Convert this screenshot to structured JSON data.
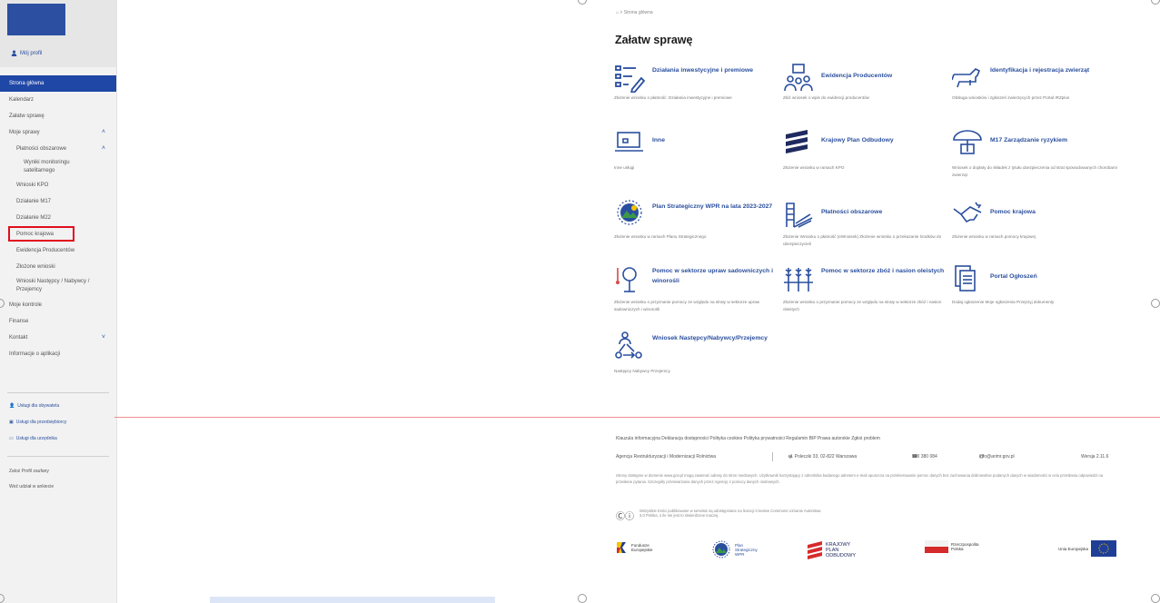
{
  "sidebar": {
    "profile_label": "Mój profil",
    "nav": [
      {
        "label": "Strona główna",
        "active": true
      },
      {
        "label": "Kalendarz"
      },
      {
        "label": "Załatw sprawę"
      },
      {
        "label": "Moje sprawy",
        "chevron": "up"
      },
      {
        "label": "Płatności obszarowe",
        "chevron": "up",
        "level": 1
      },
      {
        "label": "Wyniki monitoringu satelitarnego",
        "level": 2
      },
      {
        "label": "Wnioski KPO",
        "level": 1
      },
      {
        "label": "Działanie M17",
        "level": 1
      },
      {
        "label": "Działanie M22",
        "level": 1
      },
      {
        "label": "Pomoc krajowa",
        "level": 1,
        "highlight": true
      },
      {
        "label": "Ewidencja Producentów",
        "level": 1
      },
      {
        "label": "Złożone wnioski",
        "level": 1
      },
      {
        "label": "Wnioski Następcy / Nabywcy / Przejemcy",
        "level": 1
      },
      {
        "label": "Moje kontrole"
      },
      {
        "label": "Finanse"
      },
      {
        "label": "Kontakt",
        "chevron": "down"
      },
      {
        "label": "Informacje o aplikacji"
      }
    ],
    "services": [
      "Usługi dla obywatela",
      "Usługi dla przedsiębiorcy",
      "Usługi dla urzędnika"
    ],
    "footer_links": [
      "Zaloż Profil zaufany",
      "Weź udział w ankiecie"
    ]
  },
  "main": {
    "breadcrumb": "Strona główna",
    "title": "Załatw sprawę",
    "tiles": [
      {
        "title": "Działania inwestycyjne i premiowe",
        "desc": "Złożenie wniosku o płatność. Działania inwestycyjne i premiowe",
        "icon": "form-pen-icon"
      },
      {
        "title": "Ewidencja Producentów",
        "desc": "Złóż wniosek o wpis do ewidencji producentów",
        "icon": "people-icon"
      },
      {
        "title": "Identyfikacja i rejestracja zwierząt",
        "desc": "Obsługa wniosków i zgłoszeń zwierzęcych przez Portal IRZplus",
        "icon": "cow-icon"
      },
      {
        "title": "Inne",
        "desc": "Inne usługi",
        "icon": "laptop-icon"
      },
      {
        "title": "Krajowy Plan Odbudowy",
        "desc": "Złożenie wniosku w ramach KPO",
        "icon": "kpo-icon"
      },
      {
        "title": "M17 Zarządzanie ryzykiem",
        "desc": "Wniosek o dopłaty do składek z tytułu ubezpieczenia od strat spowodowanych chorobami zwierząt",
        "icon": "umbrella-icon"
      },
      {
        "title": "Plan Strategiczny WPR na lata 2023-2027",
        "desc": "Złożenie wniosku w ramach Planu Strategicznego",
        "icon": "wpr-icon"
      },
      {
        "title": "Płatności obszarowe",
        "desc": "Złożenie Wniosku o płatność (eWniosek) Złożenie wniosku o przekazanie środków do ubezpieczycieli",
        "icon": "fields-icon"
      },
      {
        "title": "Pomoc krajowa",
        "desc": "Złożenie wniosku w ramach pomocy krajowej",
        "icon": "handshake-icon"
      },
      {
        "title": "Pomoc w sektorze upraw sadowniczych i winorośli",
        "desc": "Złożenie wniosku o przyznanie pomocy ze względu na straty w sektorze upraw sadowniczych i winorośli",
        "icon": "fruit-tree-icon"
      },
      {
        "title": "Pomoc w sektorze zbóż i nasion oleistych",
        "desc": "Złożenie wniosku o przyznanie pomocy ze względu na straty w sektorze zbóż i nasion oleistych",
        "icon": "grain-icon"
      },
      {
        "title": "Portal Ogłoszeń",
        "desc": "Dodaj ogłoszenie Moje ogłoszenia Przejrzyj dokumenty",
        "icon": "documents-icon"
      },
      {
        "title": "Wniosek Następcy/Nabywcy/Przejemcy",
        "desc": "Następcy Nabywcy Przejemcy",
        "icon": "transfer-icon"
      }
    ]
  },
  "footer": {
    "links": "Klauzula informacyjna   Deklaracja dostępności   Polityka cookies   Polityka prywatności   Regulamin   BIP   Prawa autorskie   Zgłoś problem",
    "agency": "Agencja Restrukturyzacji i Modernizacji Rolnictwa",
    "address": "ul. Poleczki 33, 02-822 Warszawa",
    "phone": "800 380 084",
    "email": "info@arimr.gov.pl",
    "version": "Wersja 2.11.6",
    "legal": "Strony dostępne w domenie www.gov.pl mogą zawierać adresy do stron mediowych. Użytkownik korzystający z odnośnika badanego adresem e-mail opuszcza na przekierowanie pomoc danych bez zachowania dobrowolnie podanych danych w wiadomości w celu przesłania odpowiedzi na przesłane pytania. Szczegóły przetwarzania danych przez Agencję z pomocy danych osobowych.",
    "cc_text": "Wszystkie treści publikowane w serwisie są udostępniane na licencji Creative Commons Uznanie Autorstwa 3.0 Polska, o ile nie jest to stwierdzone inaczej.",
    "logos": [
      "Fundusze Europejskie",
      "Plan Strategiczny WPR",
      "KRAJOWY PLAN ODBUDOWY",
      "Rzeczpospolita Polska",
      "Unia Europejska"
    ]
  },
  "colors": {
    "accent": "#2a4f9e",
    "active_nav": "#1f47a6",
    "highlight": "#e10e1c",
    "divider": "#f08e8e"
  }
}
